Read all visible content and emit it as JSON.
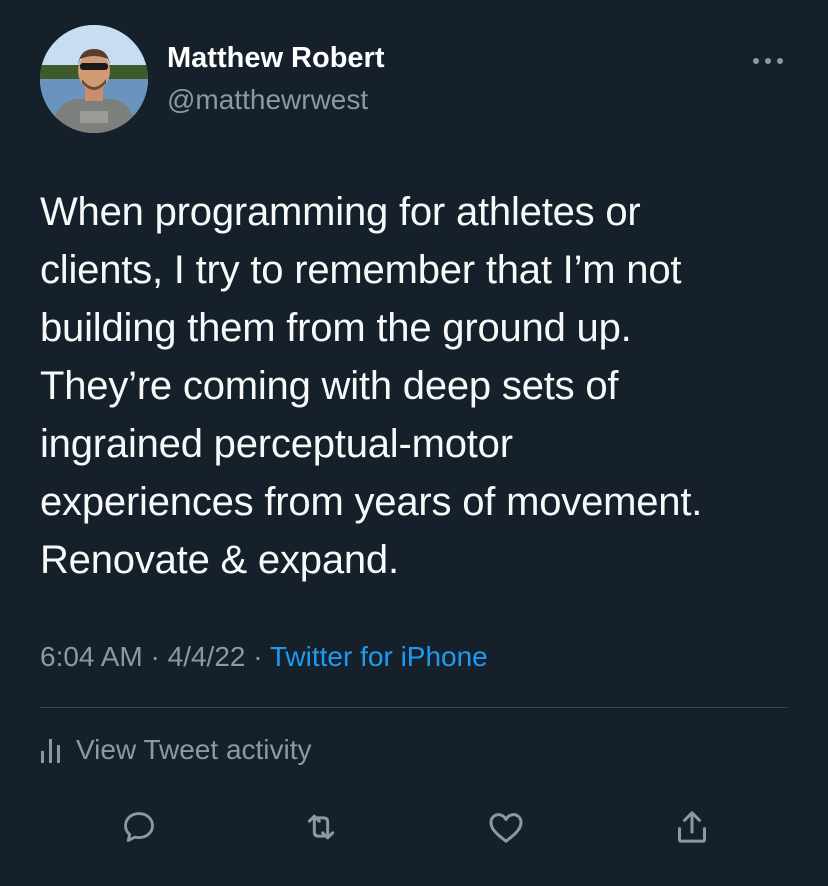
{
  "author": {
    "name": "Matthew Robert",
    "handle": "@matthewrwest"
  },
  "tweet": {
    "lines": [
      "When programming for athletes or",
      "clients, I try to remember that I’m not",
      "building them from the ground up.",
      "They’re coming with deep sets of",
      "ingrained perceptual-motor",
      "experiences from years of movement.",
      "Renovate & expand."
    ],
    "time": "6:04 AM",
    "separator": "·",
    "date": "4/4/22",
    "source": "Twitter for iPhone"
  },
  "activity": {
    "label": "View Tweet activity"
  },
  "actions": {
    "icons": [
      "reply-icon",
      "retweet-icon",
      "like-icon",
      "share-icon"
    ]
  },
  "colors": {
    "background": "#15202b",
    "text": "#f7f9f9",
    "secondary": "#8b98a5",
    "accent": "#1d9bf0",
    "divider": "#38444d"
  }
}
